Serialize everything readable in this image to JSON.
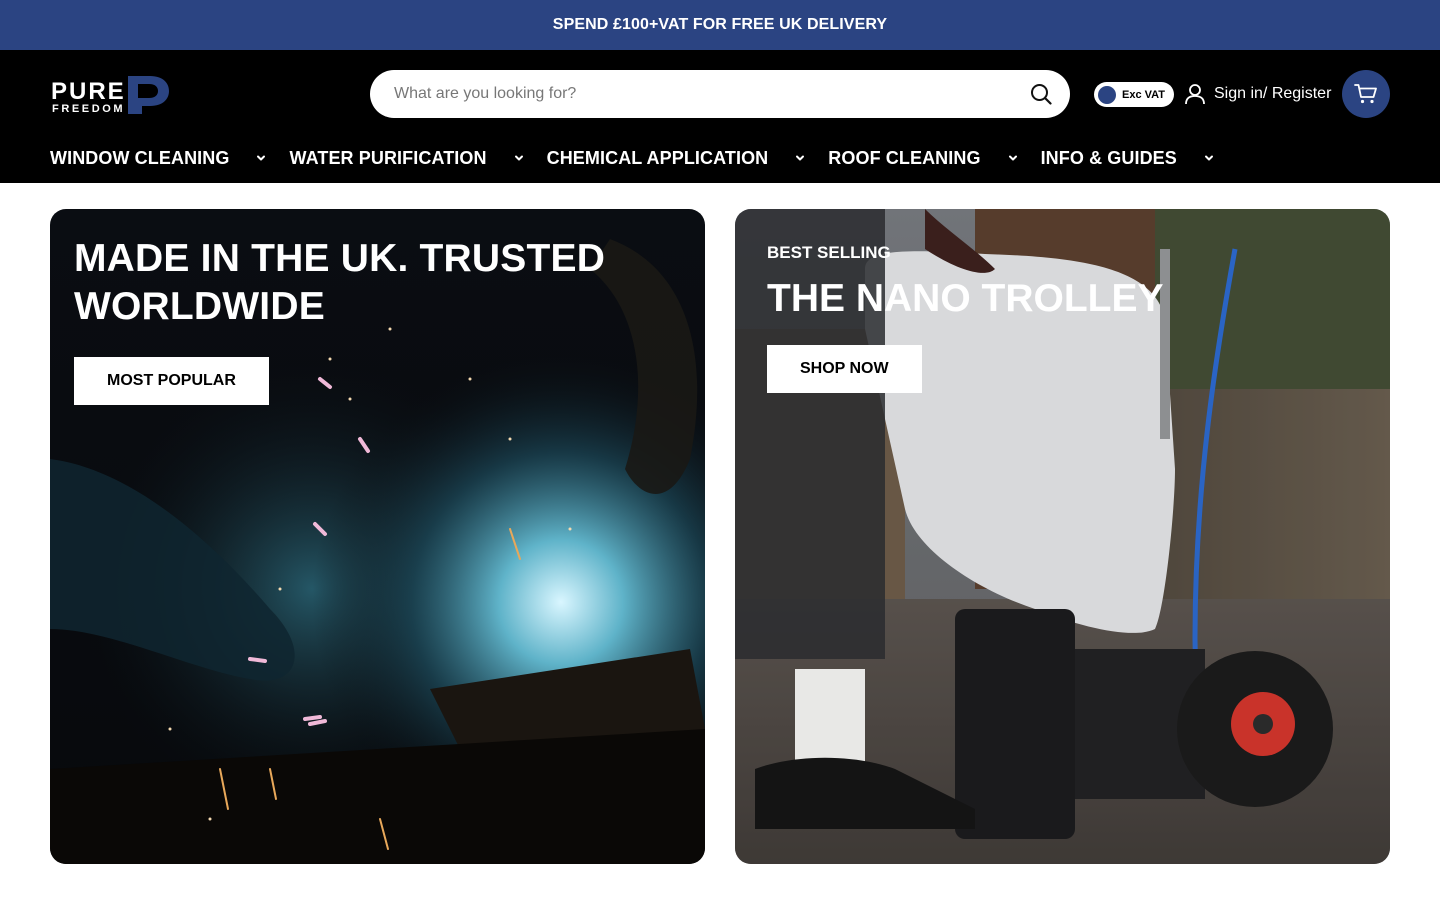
{
  "announcement": {
    "text": "SPEND £100+VAT FOR FREE UK DELIVERY"
  },
  "header": {
    "logo": {
      "word_top": "PURE",
      "word_bottom": "FREEDOM",
      "mark_letter": "P"
    },
    "search": {
      "placeholder": "What are you looking for?",
      "value": "",
      "icon": "search-icon"
    },
    "vat_toggle": {
      "label": "Exc VAT"
    },
    "account": {
      "label": "Sign in/ Register",
      "icon": "user-icon"
    },
    "cart": {
      "icon": "cart-icon"
    }
  },
  "nav": {
    "items": [
      {
        "label": "WINDOW CLEANING"
      },
      {
        "label": "WATER PURIFICATION"
      },
      {
        "label": "CHEMICAL APPLICATION"
      },
      {
        "label": "ROOF CLEANING"
      },
      {
        "label": "INFO & GUIDES"
      }
    ]
  },
  "hero": {
    "left": {
      "heading": "MADE IN THE UK. TRUSTED WORLDWIDE",
      "button": "MOST POPULAR"
    },
    "right": {
      "eyebrow": "BEST SELLING",
      "heading": "THE NANO TROLLEY",
      "button": "SHOP NOW"
    }
  },
  "colors": {
    "brand_blue": "#2b4482",
    "header_bg": "#000000",
    "text_light": "#ffffff"
  }
}
